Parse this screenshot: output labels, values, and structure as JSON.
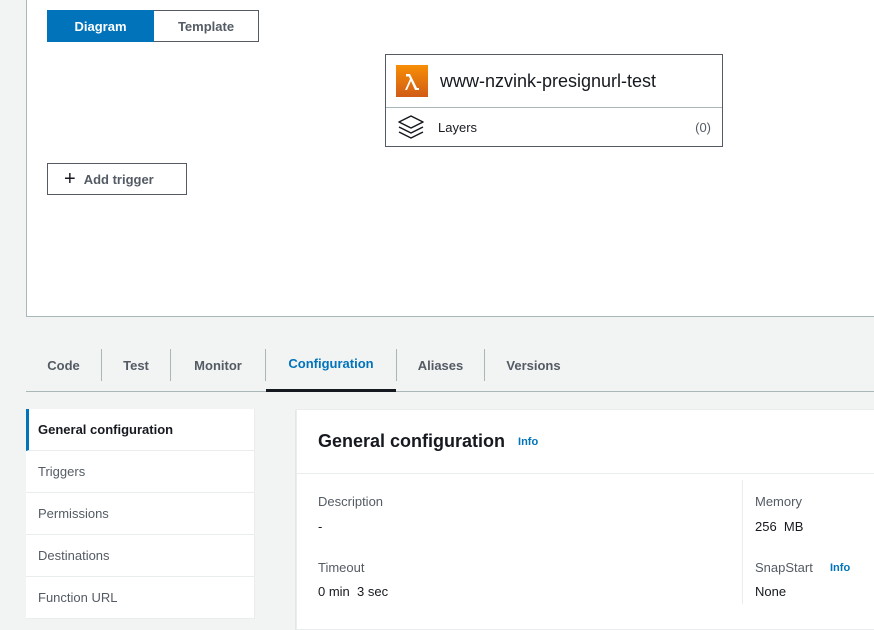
{
  "view_toggle": {
    "diagram": "Diagram",
    "template": "Template"
  },
  "function": {
    "name": "www-nzvink-presignurl-test",
    "layers_label": "Layers",
    "layers_count": "(0)"
  },
  "add_trigger_label": "Add trigger",
  "tabs": [
    "Code",
    "Test",
    "Monitor",
    "Configuration",
    "Aliases",
    "Versions"
  ],
  "active_tab": "Configuration",
  "sidenav": [
    "General configuration",
    "Triggers",
    "Permissions",
    "Destinations",
    "Function URL"
  ],
  "general_config": {
    "title": "General configuration",
    "info": "Info",
    "description_label": "Description",
    "description_value": "-",
    "timeout_label": "Timeout",
    "timeout_value": "0 min  3 sec",
    "memory_label": "Memory",
    "memory_value": "256  MB",
    "snapstart_label": "SnapStart",
    "snapstart_info": "Info",
    "snapstart_value": "None"
  },
  "colors": {
    "accent": "#0073bb",
    "lambda_orange": "#f78e04"
  }
}
